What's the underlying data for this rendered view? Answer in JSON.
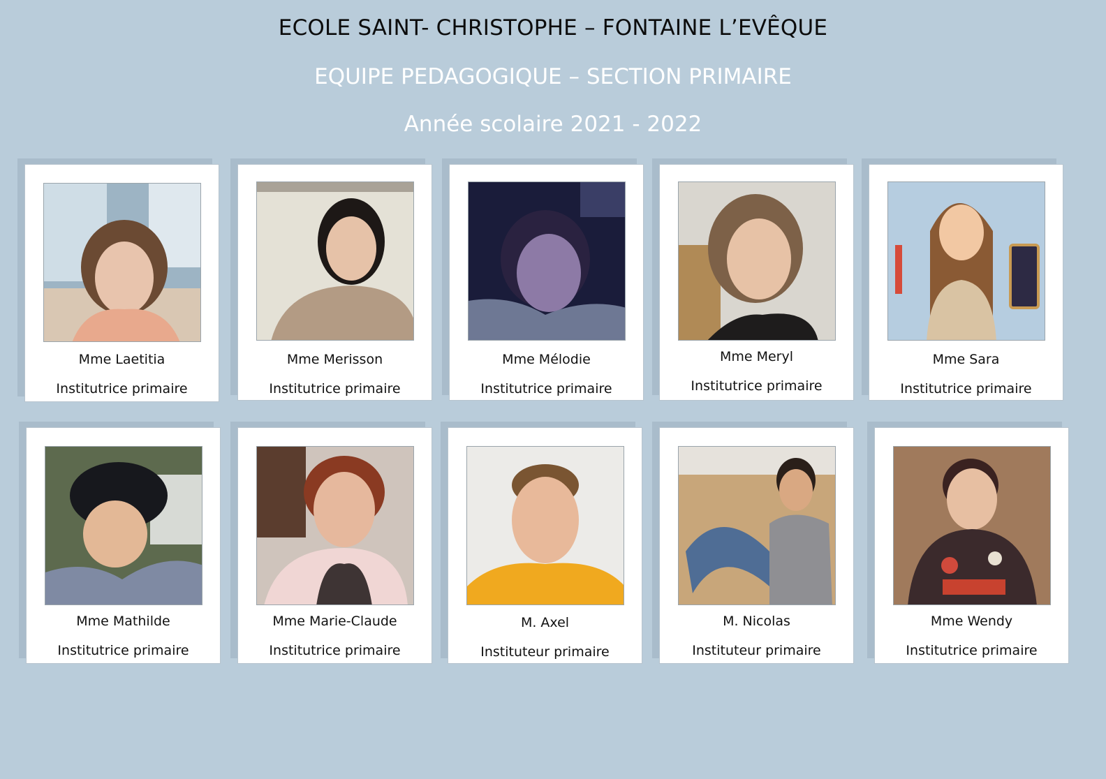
{
  "header": {
    "school": "ECOLE SAINT- CHRISTOPHE – FONTAINE L’EVÊQUE",
    "team": "EQUIPE PEDAGOGIQUE – SECTION PRIMAIRE",
    "year": "Année scolaire 2021 - 2022"
  },
  "teachers": [
    {
      "name": "Mme Laetitia",
      "role": "Institutrice primaire"
    },
    {
      "name": "Mme Merisson",
      "role": "Institutrice primaire"
    },
    {
      "name": "Mme Mélodie",
      "role": "Institutrice primaire"
    },
    {
      "name": "Mme Meryl",
      "role": "Institutrice primaire"
    },
    {
      "name": "Mme Sara",
      "role": "Institutrice primaire"
    },
    {
      "name": "Mme Mathilde",
      "role": "Institutrice primaire"
    },
    {
      "name": "Mme Marie-Claude",
      "role": "Institutrice primaire"
    },
    {
      "name": "M. Axel",
      "role": "Instituteur primaire"
    },
    {
      "name": "M. Nicolas",
      "role": "Instituteur primaire"
    },
    {
      "name": "Mme Wendy",
      "role": "Institutrice primaire"
    }
  ]
}
